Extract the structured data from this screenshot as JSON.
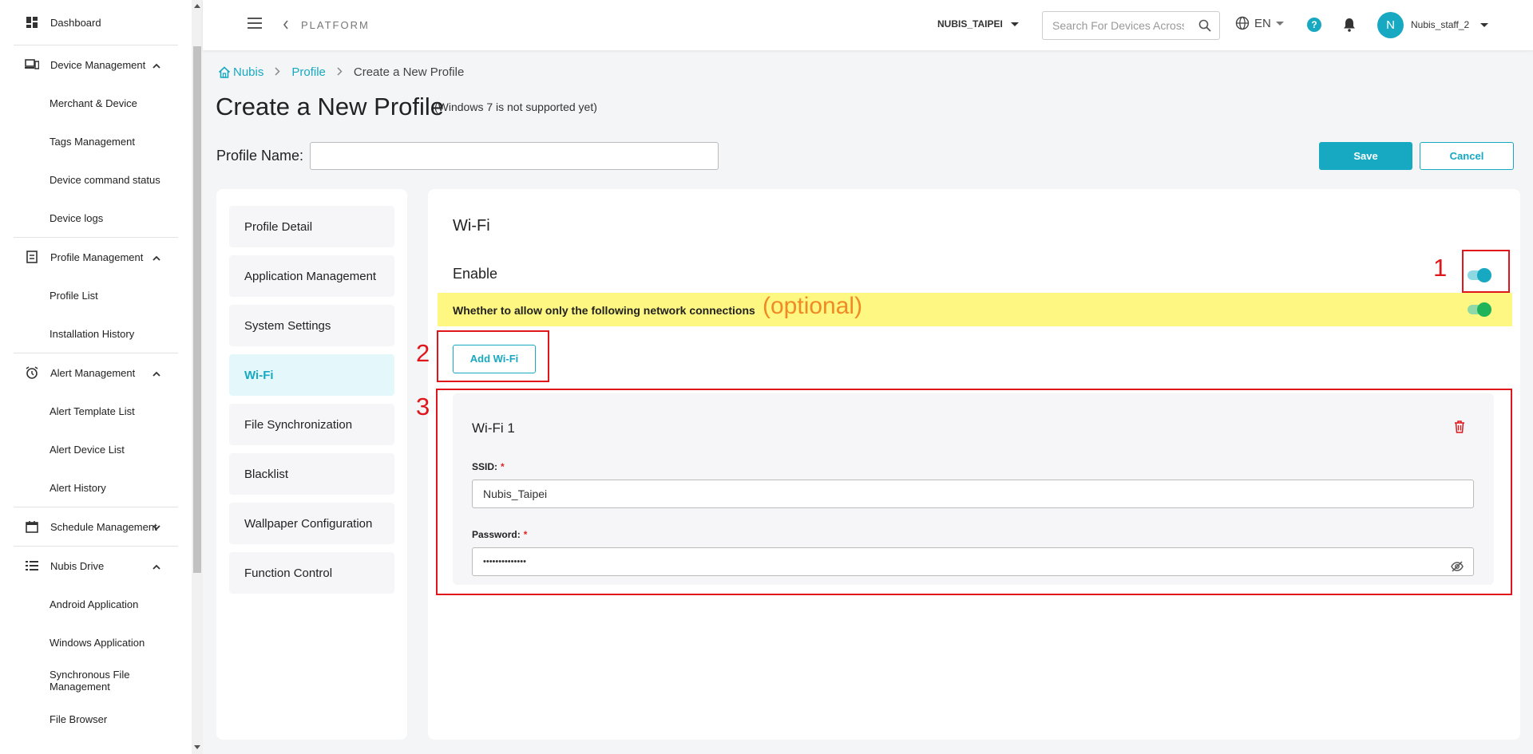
{
  "sidebar": {
    "dashboard": "Dashboard",
    "device_management": {
      "label": "Device Management",
      "items": [
        "Merchant & Device",
        "Tags Management",
        "Device command status",
        "Device logs"
      ]
    },
    "profile_management": {
      "label": "Profile Management",
      "items": [
        "Profile List",
        "Installation History"
      ]
    },
    "alert_management": {
      "label": "Alert Management",
      "items": [
        "Alert Template List",
        "Alert Device List",
        "Alert History"
      ]
    },
    "schedule_management": {
      "label": "Schedule Management"
    },
    "nubis_drive": {
      "label": "Nubis Drive",
      "items": [
        "Android Application",
        "Windows Application",
        "Synchronous File Management",
        "File Browser"
      ]
    }
  },
  "header": {
    "platform": "PLATFORM",
    "org": "NUBIS_TAIPEI",
    "search_placeholder": "Search For Devices Across",
    "lang": "EN",
    "help": "?",
    "avatar_initial": "N",
    "user": "Nubis_staff_2"
  },
  "breadcrumb": {
    "home": "Nubis",
    "profile": "Profile",
    "current": "Create a New Profile"
  },
  "page": {
    "title": "Create a New Profile",
    "note": "(Windows 7 is not supported yet)",
    "profile_name_label": "Profile Name:",
    "profile_name_value": "",
    "save": "Save",
    "cancel": "Cancel"
  },
  "nav": {
    "items": [
      "Profile Detail",
      "Application Management",
      "System Settings",
      "Wi-Fi",
      "File Synchronization",
      "Blacklist",
      "Wallpaper Configuration",
      "Function Control"
    ],
    "active_index": 3
  },
  "wifi": {
    "title": "Wi-Fi",
    "enable_label": "Enable",
    "enable_on": true,
    "allow_only_label": "Whether to allow only the following network connections",
    "allow_only_on": true,
    "add_button": "Add Wi-Fi",
    "networks": [
      {
        "title": "Wi-Fi 1",
        "ssid_label": "SSID:",
        "ssid": "Nubis_Taipei",
        "password_label": "Password:",
        "password_mask": "••••••••••••••"
      }
    ]
  },
  "annotations": {
    "n1": "1",
    "n2": "2",
    "n3": "3",
    "optional": "(optional)"
  },
  "colors": {
    "accent": "#17a9c1",
    "toggle_green": "#21b35a",
    "annotation_red": "#e0161b",
    "highlight_yellow": "#fef781",
    "optional_orange": "#f08a24"
  }
}
